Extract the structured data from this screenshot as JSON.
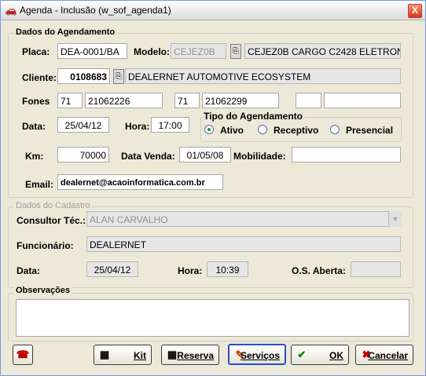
{
  "window": {
    "title": "Agenda - Inclusão (w_sof_agenda1)",
    "icon": "car-icon",
    "close": "X"
  },
  "agendamento": {
    "section_label": "Dados do Agendamento",
    "placa": {
      "label": "Placa:",
      "value": "DEA-0001/BA"
    },
    "modelo": {
      "label": "Modelo:",
      "code": "CEJEZ0B",
      "description": "CEJEZ0B CARGO C2428 ELETRON"
    },
    "cliente": {
      "label": "Cliente:",
      "code": "0108683",
      "name": "DEALERNET AUTOMOTIVE ECOSYSTEM"
    },
    "fones": {
      "label": "Fones",
      "ddd1": "71",
      "num1": "21062226",
      "ddd2": "71",
      "num2": "21062299",
      "ddd3": "",
      "num3": ""
    },
    "data": {
      "label": "Data:",
      "value": "25/04/12"
    },
    "hora": {
      "label": "Hora:",
      "value": "17:00"
    },
    "tipo": {
      "label": "Tipo do Agendamento",
      "options": [
        {
          "label": "Ativo",
          "selected": true
        },
        {
          "label": "Receptivo",
          "selected": false
        },
        {
          "label": "Presencial",
          "selected": false
        }
      ]
    },
    "km": {
      "label": "Km:",
      "value": "70000"
    },
    "data_venda": {
      "label": "Data Venda:",
      "value": "01/05/08"
    },
    "mobilidade": {
      "label": "Mobilidade:",
      "value": ""
    },
    "email": {
      "label": "Email:",
      "value": "dealernet@acaoinformatica.com.br"
    }
  },
  "cadastro": {
    "section_label": "Dados do Cadastro",
    "consultor": {
      "label": "Consultor Téc.:",
      "value": "ALAN CARVALHO"
    },
    "funcionario": {
      "label": "Funcionário:",
      "value": "DEALERNET"
    },
    "data": {
      "label": "Data:",
      "value": "25/04/12"
    },
    "hora": {
      "label": "Hora:",
      "value": "10:39"
    },
    "os_aberta": {
      "label": "O.S. Aberta:",
      "value": ""
    }
  },
  "observacoes": {
    "label": "Observações",
    "value": ""
  },
  "buttons": {
    "phone": {
      "icon": "phone-icon"
    },
    "kit": {
      "label": "Kit",
      "icon": "kit-icon"
    },
    "reserva": {
      "label": "Reserva",
      "icon": "reserva-icon"
    },
    "servicos": {
      "label": "Serviços",
      "icon": "servicos-icon"
    },
    "ok": {
      "label": "OK",
      "icon": "ok-icon"
    },
    "cancelar": {
      "label": "Cancelar",
      "icon": "cancel-icon"
    }
  }
}
